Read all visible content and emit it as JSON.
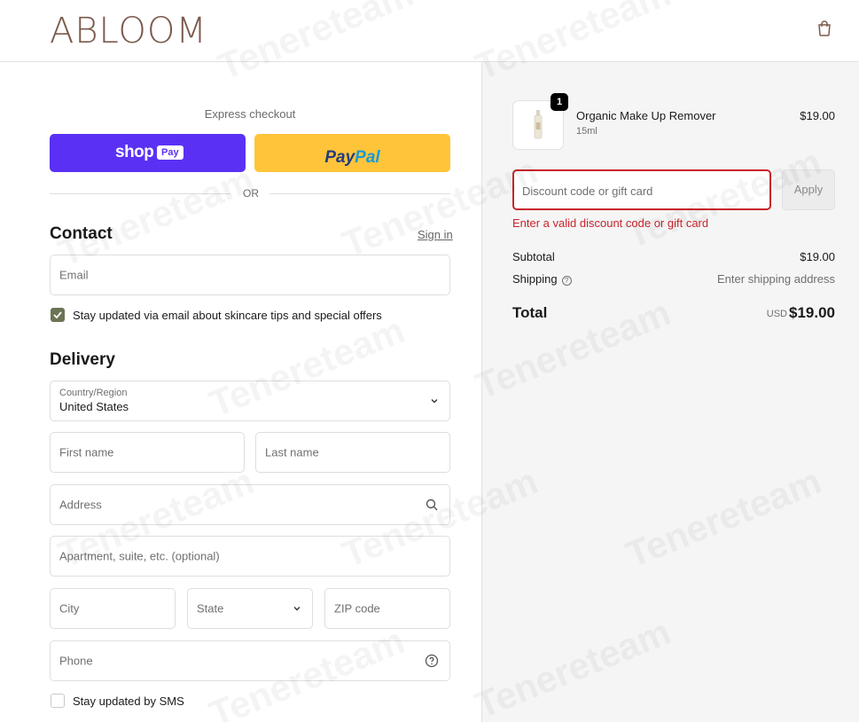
{
  "header": {
    "logo": "ABLOOM",
    "bag_icon": "shopping-bag-icon"
  },
  "express": {
    "label": "Express checkout",
    "shop_pay": {
      "shop": "shop",
      "pay": "Pay"
    },
    "paypal": {
      "pay": "Pay",
      "pal": "Pal"
    },
    "or": "OR"
  },
  "contact": {
    "title": "Contact",
    "sign_in": "Sign in",
    "email_placeholder": "Email",
    "newsletter_label": "Stay updated via email about skincare tips and special offers",
    "newsletter_checked": true
  },
  "delivery": {
    "title": "Delivery",
    "country_label": "Country/Region",
    "country_value": "United States",
    "first_name": "First name",
    "last_name": "Last name",
    "address": "Address",
    "apartment": "Apartment, suite, etc. (optional)",
    "city": "City",
    "state": "State",
    "zip": "ZIP code",
    "phone": "Phone",
    "sms_label": "Stay updated by SMS",
    "sms_checked": false
  },
  "order": {
    "item": {
      "quantity": "1",
      "name": "Organic Make Up Remover",
      "variant": "15ml",
      "price": "$19.00"
    },
    "discount": {
      "placeholder": "Discount code or gift card",
      "apply": "Apply",
      "error": "Enter a valid discount code or gift card"
    },
    "summary": {
      "subtotal_label": "Subtotal",
      "subtotal_value": "$19.00",
      "shipping_label": "Shipping",
      "shipping_value": "Enter shipping address",
      "total_label": "Total",
      "currency": "USD",
      "total_value": "$19.00"
    }
  },
  "watermark": "Tenereteam",
  "colors": {
    "brand": "#7b5a4c",
    "shop_pay": "#5a31f4",
    "paypal": "#ffc439",
    "checkbox": "#6b7555",
    "error": "#c8252c"
  }
}
